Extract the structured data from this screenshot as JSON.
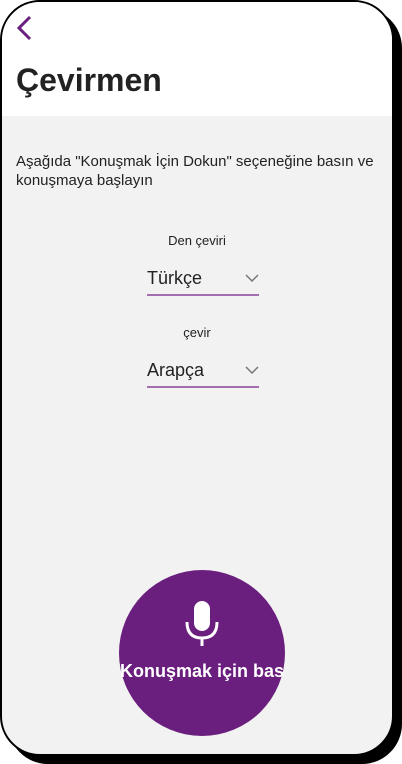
{
  "header": {
    "title": "Çevirmen",
    "back_icon": "chevron-left-icon"
  },
  "instructions": "Aşağıda \"Konuşmak İçin Dokun\" seçeneğine basın ve konuşmaya başlayın",
  "source": {
    "label": "Den çeviri",
    "value": "Türkçe"
  },
  "target": {
    "label": "çevir",
    "value": "Arapça"
  },
  "mic_button": {
    "label": "Konuşmak için bas",
    "icon": "microphone-icon"
  },
  "colors": {
    "accent": "#6a1e7d",
    "underline": "#a36fb1"
  }
}
